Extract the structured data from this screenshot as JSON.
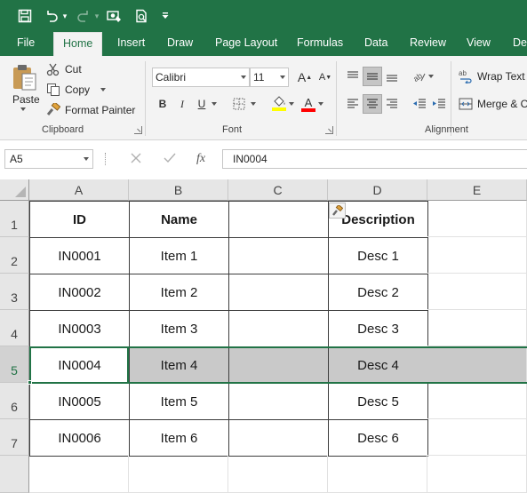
{
  "tabs": [
    "File",
    "Home",
    "Insert",
    "Draw",
    "Page Layout",
    "Formulas",
    "Data",
    "Review",
    "View",
    "Dev"
  ],
  "active_tab": "Home",
  "clipboard": {
    "paste_label": "Paste",
    "cut_label": "Cut",
    "copy_label": "Copy",
    "format_painter_label": "Format Painter",
    "group_label": "Clipboard"
  },
  "font": {
    "name": "Calibri",
    "size": "11",
    "bold": "B",
    "italic": "I",
    "underline": "U",
    "font_color_glyph": "A",
    "group_label": "Font"
  },
  "alignment": {
    "wrap_text_label": "Wrap Text",
    "merge_label": "Merge & C",
    "group_label": "Alignment"
  },
  "formula_bar": {
    "name_box": "A5",
    "fx": "fx",
    "formula": "IN0004"
  },
  "columns": [
    "A",
    "B",
    "C",
    "D",
    "E"
  ],
  "rows": [
    "1",
    "2",
    "3",
    "4",
    "5",
    "6",
    "7"
  ],
  "selected_row": "5",
  "table": {
    "headers": [
      "ID",
      "Name",
      "",
      "Description"
    ],
    "rows": [
      [
        "IN0001",
        "Item 1",
        "",
        "Desc 1"
      ],
      [
        "IN0002",
        "Item 2",
        "",
        "Desc 2"
      ],
      [
        "IN0003",
        "Item 3",
        "",
        "Desc 3"
      ],
      [
        "IN0004",
        "Item 4",
        "",
        "Desc 4"
      ],
      [
        "IN0005",
        "Item 5",
        "",
        "Desc 5"
      ],
      [
        "IN0006",
        "Item 6",
        "",
        "Desc 6"
      ]
    ]
  },
  "colors": {
    "excel_green": "#217346",
    "selection_shade": "#c9c9c9",
    "ribbon_bg": "#f3f3f3"
  },
  "icons": [
    "save-icon",
    "undo-icon",
    "redo-icon",
    "touch-mode-icon",
    "print-preview-icon",
    "customize-qat-icon",
    "paste-icon",
    "cut-icon",
    "copy-icon",
    "format-painter-icon",
    "borders-icon",
    "fill-color-icon",
    "font-color-icon",
    "align-top-icon",
    "align-middle-icon",
    "align-bottom-icon",
    "orientation-icon",
    "align-left-icon",
    "align-center-icon",
    "align-right-icon",
    "decrease-indent-icon",
    "increase-indent-icon",
    "wrap-text-icon",
    "merge-icon",
    "cancel-icon",
    "enter-icon",
    "paste-options-icon"
  ]
}
